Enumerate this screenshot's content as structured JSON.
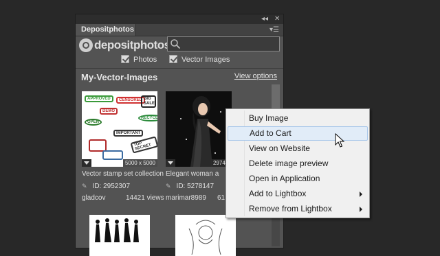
{
  "panel": {
    "tab_label": "Depositphotos",
    "logo_text": "depositphotos",
    "search": {
      "value": "",
      "placeholder": ""
    },
    "filters": [
      {
        "label": "Photos",
        "checked": true
      },
      {
        "label": "Vector Images",
        "checked": true
      }
    ],
    "section_title": "My-Vector-Images",
    "view_options": "View options",
    "items": [
      {
        "title": "Vector stamp set collection",
        "dimensions": "5000 x 5000",
        "id_text": "ID: 2952307",
        "author": "gladcov",
        "views": "14421 views"
      },
      {
        "title": "Elegant woman a",
        "dimensions": "2974 x",
        "id_text": "ID: 5278147",
        "author": "marimar8989",
        "views": "61"
      }
    ]
  },
  "context_menu": {
    "items": [
      {
        "label": "Buy Image",
        "submenu": false,
        "highlighted": false
      },
      {
        "label": "Add to Cart",
        "submenu": false,
        "highlighted": true
      },
      {
        "label": "View on Website",
        "submenu": false,
        "highlighted": false
      },
      {
        "label": "Delete image preview",
        "submenu": false,
        "highlighted": false
      },
      {
        "label": "Open in Application",
        "submenu": false,
        "highlighted": false
      },
      {
        "label": "Add to Lightbox",
        "submenu": true,
        "highlighted": false
      },
      {
        "label": "Remove from Lightbox",
        "submenu": true,
        "highlighted": false
      }
    ]
  },
  "stamp_words": [
    "APPROVED",
    "CENSORED",
    "BIG SALE",
    "DEMO",
    "OPEN",
    "IMPORTANT",
    "TOP SECRET",
    "RECYCLE"
  ],
  "colors": {
    "background": "#282828",
    "panel": "#535353",
    "menu_background": "#f0f0f0",
    "menu_highlight": "#e1ecf8"
  }
}
